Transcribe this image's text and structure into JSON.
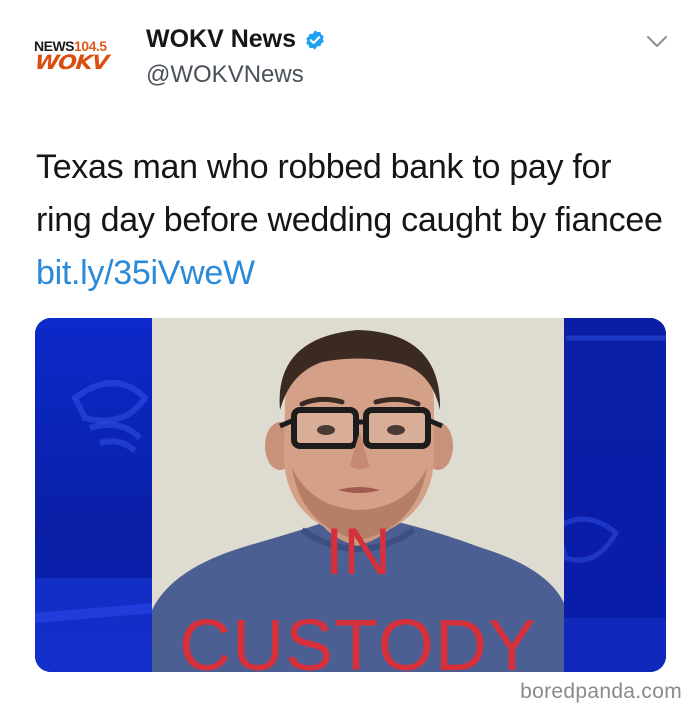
{
  "header": {
    "avatar": {
      "news_label": "NEWS",
      "frequency": "104.5",
      "call_sign": "WOKV"
    },
    "display_name": "WOKV News",
    "verified": true,
    "handle": "@WOKVNews",
    "menu_icon": "chevron-down-icon"
  },
  "tweet": {
    "text": "Texas man who robbed bank to pay for ring day before wedding caught by fiancee ",
    "link_text": "bit.ly/35iVweW"
  },
  "media": {
    "overlay_line_1": "IN",
    "overlay_line_2": "CUSTODY"
  },
  "watermark": "boredpanda.com",
  "colors": {
    "link": "#2b8ad8",
    "verified": "#1da1f2",
    "overlay_text": "#d6303a",
    "media_background": "#0a1fa6",
    "brand_orange": "#e25a1c"
  }
}
